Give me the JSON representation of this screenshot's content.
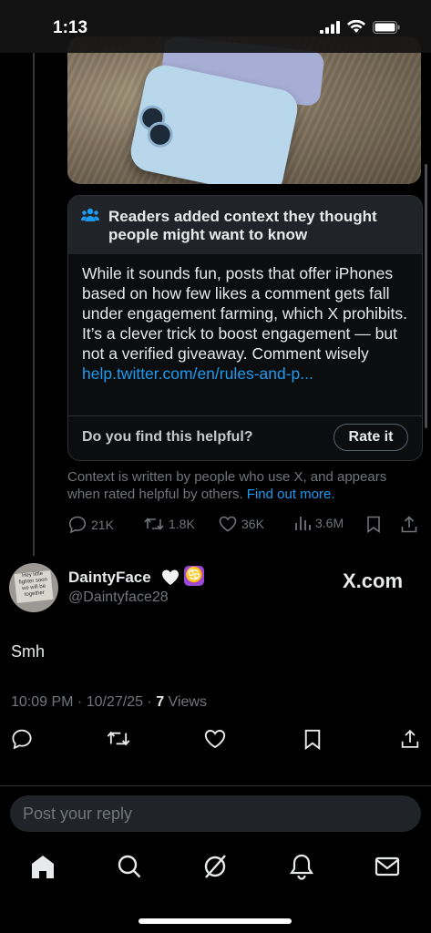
{
  "status_bar": {
    "time": "1:13"
  },
  "note": {
    "title": "Readers added context they thought people might want to know",
    "body": "While it sounds fun, posts that offer iPhones based on how few likes a comment gets fall under engagement farming, which X prohibits. It’s a clever trick to boost engagement — but not a verified giveaway. Comment wisely",
    "link": "help.twitter.com/en/rules-and-p...",
    "helpful_question": "Do you find this helpful?",
    "rate_label": "Rate it"
  },
  "context_footer": {
    "text": "Context is written by people who use X, and appears when rated helpful by others.",
    "link": "Find out more."
  },
  "actions": {
    "replies": "21K",
    "reposts": "1.8K",
    "likes": "36K",
    "views": "3.6M"
  },
  "reply_post": {
    "name": "DaintyFace",
    "emoji_zodiac": "♋",
    "handle": "@Daintyface28",
    "badge": "X.com",
    "text": "Smh",
    "datetime": "10:09 PM · 10/27/25 · ",
    "views_count": "7",
    "views_label": " Views",
    "avatar_text": "Hey little fighter soon we will be together"
  },
  "composer": {
    "placeholder": "Post your reply"
  },
  "colors": {
    "accent": "#1d9bf0",
    "background": "#000000",
    "muted": "#71767b"
  },
  "icons": [
    "home-icon",
    "search-icon",
    "grok-icon",
    "notifications-icon",
    "messages-icon"
  ]
}
